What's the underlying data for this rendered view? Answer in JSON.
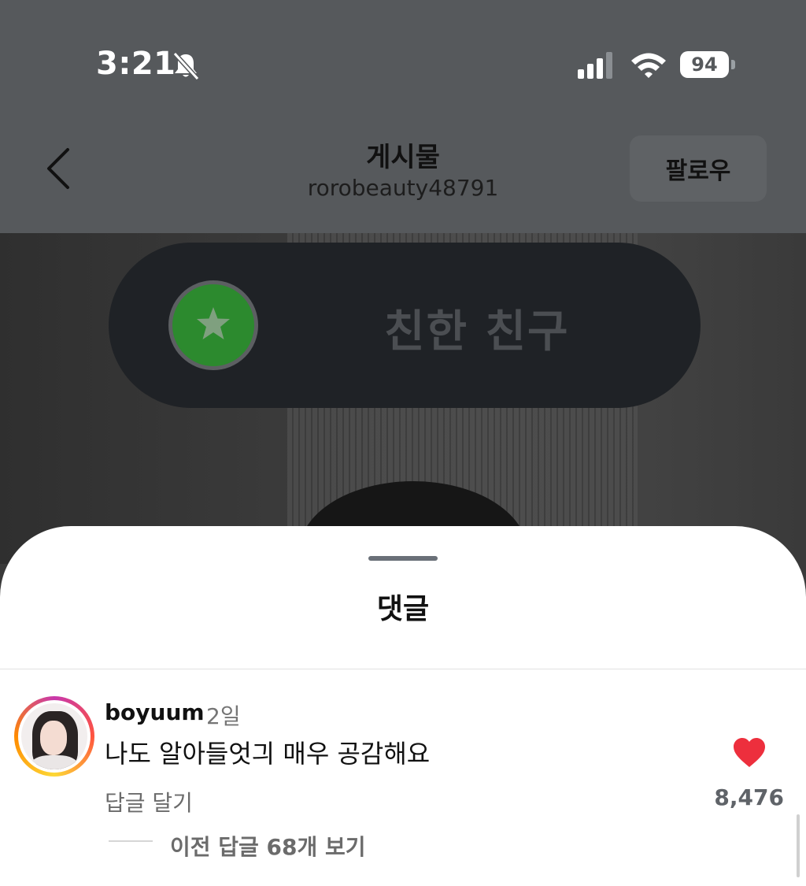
{
  "status_bar": {
    "time": "3:21",
    "battery": "94",
    "icons": [
      "bell-slash-icon",
      "cellular-signal-icon",
      "wifi-icon",
      "battery-icon"
    ]
  },
  "header": {
    "title": "게시물",
    "username": "rorobeauty48791",
    "follow_label": "팔로우",
    "back_icon": "chevron-left-icon"
  },
  "photo": {
    "close_friends_label": "친한 친구",
    "badge_icon": "star-icon",
    "badge_color": "#2c8a2e"
  },
  "comments_sheet": {
    "title": "댓글",
    "comments": [
      {
        "username": "boyuum",
        "time": "2일",
        "text": "나도 알아들엇긔 매우 공감해요",
        "reply_label": "답글 달기",
        "like_count": "8,476",
        "liked": true,
        "like_color": "#ed2f3d",
        "view_replies_label": "이전 답글 68개 보기"
      }
    ]
  }
}
